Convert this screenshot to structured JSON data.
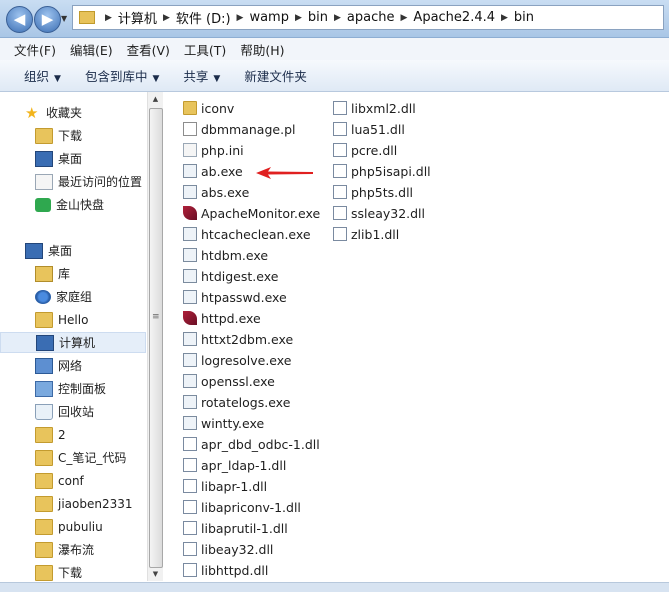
{
  "addressbar": {
    "crumbs": [
      "计算机",
      "软件 (D:)",
      "wamp",
      "bin",
      "apache",
      "Apache2.4.4",
      "bin"
    ]
  },
  "menu": [
    "文件(F)",
    "编辑(E)",
    "查看(V)",
    "工具(T)",
    "帮助(H)"
  ],
  "toolbar": {
    "organize": "组织",
    "include": "包含到库中",
    "share": "共享",
    "new_folder": "新建文件夹"
  },
  "nav": {
    "favorites": "收藏夹",
    "fav_items": [
      "下载",
      "桌面",
      "最近访问的位置",
      "金山快盘"
    ],
    "desktop": "桌面",
    "desk_items": [
      "库",
      "家庭组",
      "Hello",
      "计算机",
      "网络",
      "控制面板",
      "回收站",
      "2",
      "C_笔记_代码",
      "conf",
      "jiaoben2331",
      "pubuliu",
      "瀑布流",
      "下载"
    ]
  },
  "files": {
    "col1": [
      "iconv",
      "dbmmanage.pl",
      "php.ini",
      "ab.exe",
      "abs.exe",
      "ApacheMonitor.exe",
      "htcacheclean.exe",
      "htdbm.exe",
      "htdigest.exe",
      "htpasswd.exe",
      "httpd.exe",
      "httxt2dbm.exe",
      "logresolve.exe",
      "openssl.exe",
      "rotatelogs.exe",
      "wintty.exe",
      "apr_dbd_odbc-1.dll",
      "apr_ldap-1.dll",
      "libapr-1.dll",
      "libapriconv-1.dll",
      "libaprutil-1.dll",
      "libeay32.dll",
      "libhttpd.dll"
    ],
    "col2": [
      "libxml2.dll",
      "lua51.dll",
      "pcre.dll",
      "php5isapi.dll",
      "php5ts.dll",
      "ssleay32.dll",
      "zlib1.dll"
    ]
  },
  "annotation": {
    "arrow_color": "#e02020"
  }
}
